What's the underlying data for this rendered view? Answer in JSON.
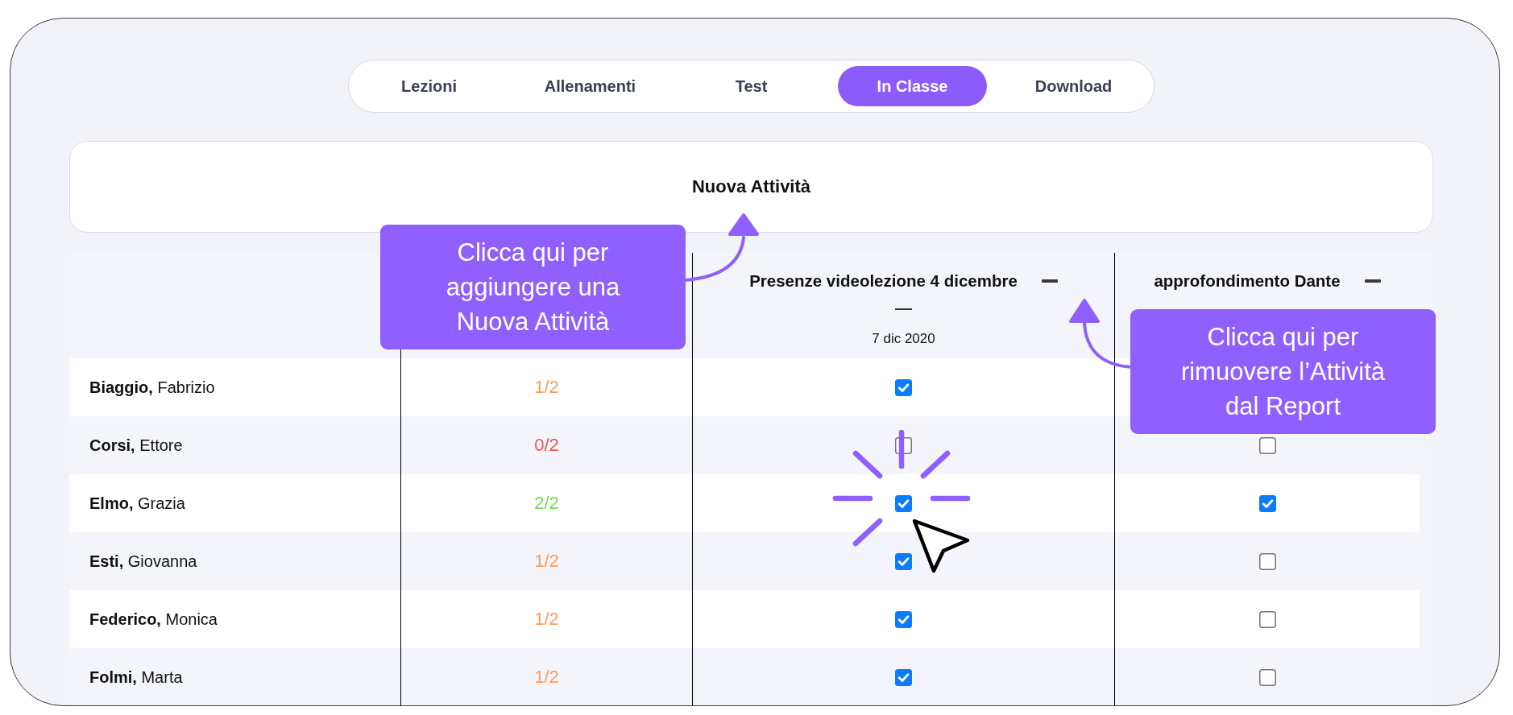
{
  "tabs": [
    {
      "label": "Lezioni",
      "selected": false
    },
    {
      "label": "Allenamenti",
      "selected": false
    },
    {
      "label": "Test",
      "selected": false
    },
    {
      "label": "In Classe",
      "selected": true
    },
    {
      "label": "Download",
      "selected": false
    }
  ],
  "new_activity": {
    "label": "Nuova Attività"
  },
  "table": {
    "activities": [
      {
        "title": "Presenze videolezione 4 dicembre",
        "subtitle": "—",
        "date": "7 dic 2020"
      },
      {
        "title": "approfondimento Dante"
      }
    ],
    "rows": [
      {
        "student": "**Biaggio,** Fabrizio",
        "score": "1/2",
        "color": "#ff9b57",
        "checks": [
          {
            "checked": true
          }
        ]
      },
      {
        "student": "**Corsi,** Ettore",
        "score": "0/2",
        "color": "#ff4e4e",
        "checks": [
          {
            "checked": false
          },
          {
            "checked": false
          }
        ]
      },
      {
        "student": "**Elmo,** Grazia",
        "score": "2/2",
        "color": "#6ee04a",
        "checks": [
          {
            "checked": true
          },
          {
            "checked": true
          }
        ]
      },
      {
        "student": "**Esti,** Giovanna",
        "score": "1/2",
        "color": "#ff9b57",
        "checks": [
          {
            "checked": true
          },
          {
            "checked": false
          }
        ]
      },
      {
        "student": "**Federico,** Monica",
        "score": "1/2",
        "color": "#ff9b57",
        "checks": [
          {
            "checked": true
          },
          {
            "checked": false
          }
        ]
      },
      {
        "student": "**Folmi,** Marta",
        "score": "1/2",
        "color": "#ff9b57",
        "checks": [
          {
            "checked": true
          },
          {
            "checked": false
          }
        ]
      }
    ]
  },
  "callouts": [
    {
      "text": "Clicca qui per\naggiungere una\nNuova Attività"
    },
    {
      "text": "Clicca qui per\nrimuovere l’Attività\ndal Report"
    }
  ]
}
